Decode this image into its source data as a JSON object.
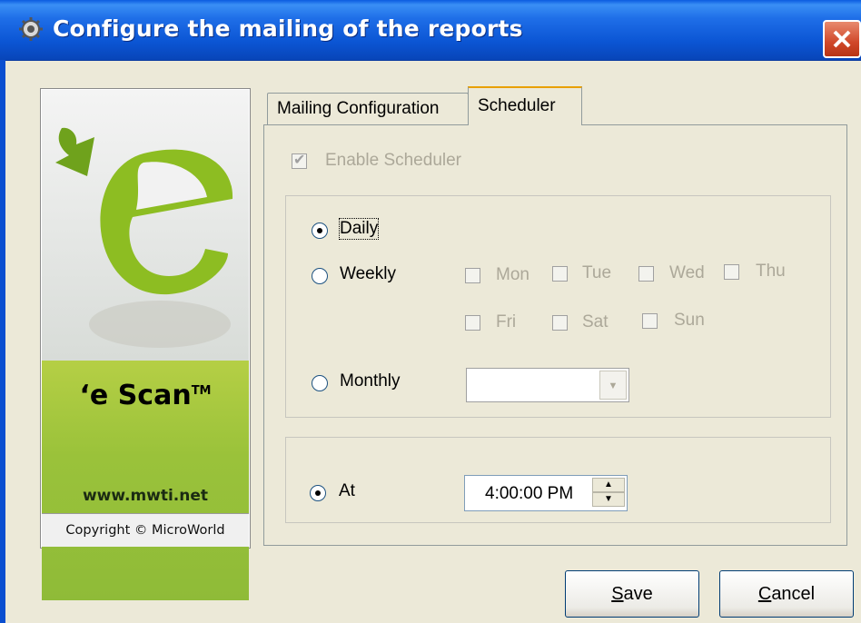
{
  "window": {
    "title": "Configure the mailing of the reports"
  },
  "side_panel": {
    "brand": "‘e Scan",
    "trademark": "TM",
    "url": "www.mwti.net",
    "copyright": "Copyright © MicroWorld"
  },
  "tabs": [
    {
      "label": "Mailing Configuration",
      "selected": false
    },
    {
      "label": "Scheduler",
      "selected": true
    }
  ],
  "scheduler": {
    "enable_label": "Enable Scheduler",
    "enable_checked": true,
    "enable_disabled": true,
    "frequency": {
      "selected": "Daily",
      "daily_label": "Daily",
      "weekly_label": "Weekly",
      "monthly_label": "Monthly"
    },
    "weekdays": [
      {
        "label": "Mon",
        "checked": false
      },
      {
        "label": "Tue",
        "checked": false
      },
      {
        "label": "Wed",
        "checked": false
      },
      {
        "label": "Thu",
        "checked": false
      },
      {
        "label": "Fri",
        "checked": false
      },
      {
        "label": "Sat",
        "checked": false
      },
      {
        "label": "Sun",
        "checked": false
      }
    ],
    "monthly_value": "",
    "at_label": "At",
    "at_selected": true,
    "time": "4:00:00 PM"
  },
  "buttons": {
    "save_mnemonic": "S",
    "save_rest": "ave",
    "cancel_mnemonic": "C",
    "cancel_rest": "ancel"
  },
  "icons": {
    "title": "gear-icon",
    "close": "close-icon",
    "combo_arrow": "chevron-down-icon",
    "spin_up": "chevron-up-icon",
    "spin_down": "chevron-down-icon"
  },
  "colors": {
    "titlebar": "#0b55d4",
    "window_bg": "#ece9d8",
    "brand_green": "#9ac23a",
    "close_button": "#d0482a"
  }
}
